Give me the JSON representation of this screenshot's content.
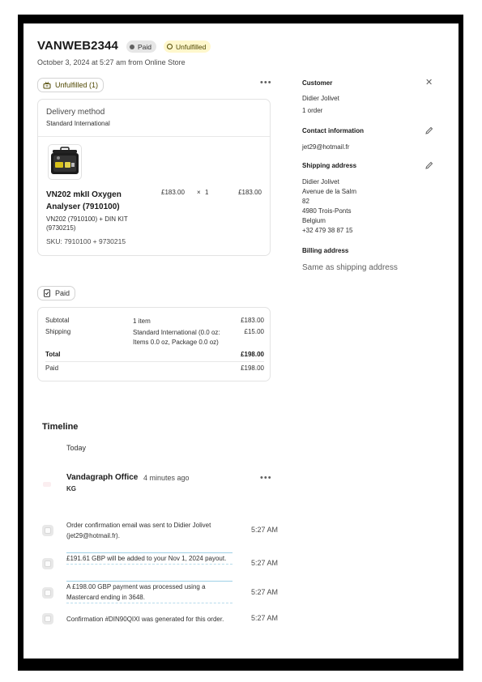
{
  "order": {
    "id": "VANWEB2344",
    "payment_badge": "Paid",
    "fulfillment_badge": "Unfulfilled",
    "meta": "October 3, 2024 at 5:27 am from Online Store"
  },
  "fulfillment": {
    "status_label": "Unfulfilled (1)",
    "more_icon": "more-horizontal-icon",
    "delivery_method_title": "Delivery method",
    "delivery_method_value": "Standard International",
    "item": {
      "name": "VN202 mkII Oxygen Analyser (7910100)",
      "variant": "VN202 (7910100) + DIN KIT (9730215)",
      "sku": "SKU: 7910100 + 9730215",
      "price": "£183.00",
      "times": "×",
      "quantity": "1",
      "total": "£183.00"
    }
  },
  "payment": {
    "status_label": "Paid",
    "rows": {
      "subtotal": {
        "label": "Subtotal",
        "desc": "1 item",
        "amount": "£183.00"
      },
      "shipping": {
        "label": "Shipping",
        "desc": "Standard International (0.0 oz: Items 0.0 oz, Package 0.0 oz)",
        "amount": "£15.00"
      },
      "total": {
        "label": "Total",
        "amount": "£198.00"
      },
      "paid": {
        "label": "Paid",
        "amount": "£198.00"
      }
    }
  },
  "customer": {
    "heading": "Customer",
    "name": "Didier Jolivet",
    "orders": "1 order",
    "contact_heading": "Contact information",
    "email": "jet29@hotmail.fr",
    "shipping_heading": "Shipping address",
    "shipping_lines": [
      "Didier Jolivet",
      "Avenue de la Salm",
      "82",
      "4980 Trois-Ponts",
      "Belgium",
      "+32 479 38 87 15"
    ],
    "billing_heading": "Billing address",
    "billing_value": "Same as shipping address"
  },
  "timeline": {
    "heading": "Timeline",
    "day": "Today",
    "comment_author": "Vandagraph Office",
    "comment_ago": "4 minutes ago",
    "comment_initials": "KG",
    "events": [
      {
        "text": "Order confirmation email was sent to Didier Jolivet (jet29@hotmail.fr).",
        "time": "5:27 AM"
      },
      {
        "text": "£191.61 GBP will be added to your Nov 1, 2024 payout.",
        "time": "5:27 AM"
      },
      {
        "text": "A £198.00 GBP payment was processed using a Mastercard ending in 3648.",
        "time": "5:27 AM"
      },
      {
        "text": "Confirmation #DIN90QIXI was generated for this order.",
        "time": "5:27 AM"
      }
    ]
  },
  "colors": {
    "unfulfilled_bg": "#fff7cc",
    "unfulfilled_text": "#4f4700",
    "paid_badge_bg": "#e6e6e6"
  }
}
